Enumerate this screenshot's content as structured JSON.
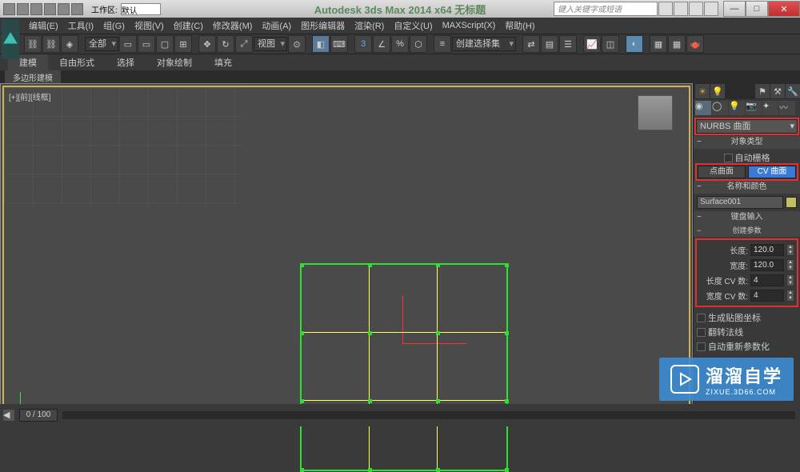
{
  "title": "Autodesk 3ds Max 2014 x64   无标题",
  "workspace": {
    "label": "工作区: ",
    "value": "默认"
  },
  "search_placeholder": "键入关键字或短语",
  "menu": [
    "编辑(E)",
    "工具(I)",
    "组(G)",
    "视图(V)",
    "创建(C)",
    "修改器(M)",
    "动画(A)",
    "图形编辑器",
    "渲染(R)",
    "自定义(U)",
    "MAXScript(X)",
    "帮助(H)"
  ],
  "toolbar": {
    "filter": "全部",
    "view": "视图",
    "selset": "创建选择集"
  },
  "ribbon": [
    "建模",
    "自由形式",
    "选择",
    "对象绘制",
    "填充"
  ],
  "ribbon_active": 0,
  "sub_tab": "多边形建模",
  "viewport": {
    "label": "[+][前][线框]"
  },
  "cmdpanel": {
    "category": "NURBS 曲面",
    "obj_type_hdr": "对象类型",
    "autogrid": "自动栅格",
    "btn_point": "点曲面",
    "btn_cv": "CV 曲面",
    "name_hdr": "名称和颜色",
    "object_name": "Surface001",
    "kbd_hdr": "键盘输入",
    "params": {
      "length_label": "长度:",
      "length": "120.0",
      "width_label": "宽度:",
      "width": "120.0",
      "lcv_label": "长度 CV 数:",
      "lcv": "4",
      "wcv_label": "宽度 CV 数:",
      "wcv": "4"
    },
    "gen_uv": "生成贴图坐标",
    "flip_n": "翻转法线",
    "auto_r": "自动重新参数化"
  },
  "timeline": {
    "slider": "0 / 100"
  },
  "watermark": {
    "big": "溜溜自学",
    "small": "ZIXUE.3D66.COM"
  }
}
